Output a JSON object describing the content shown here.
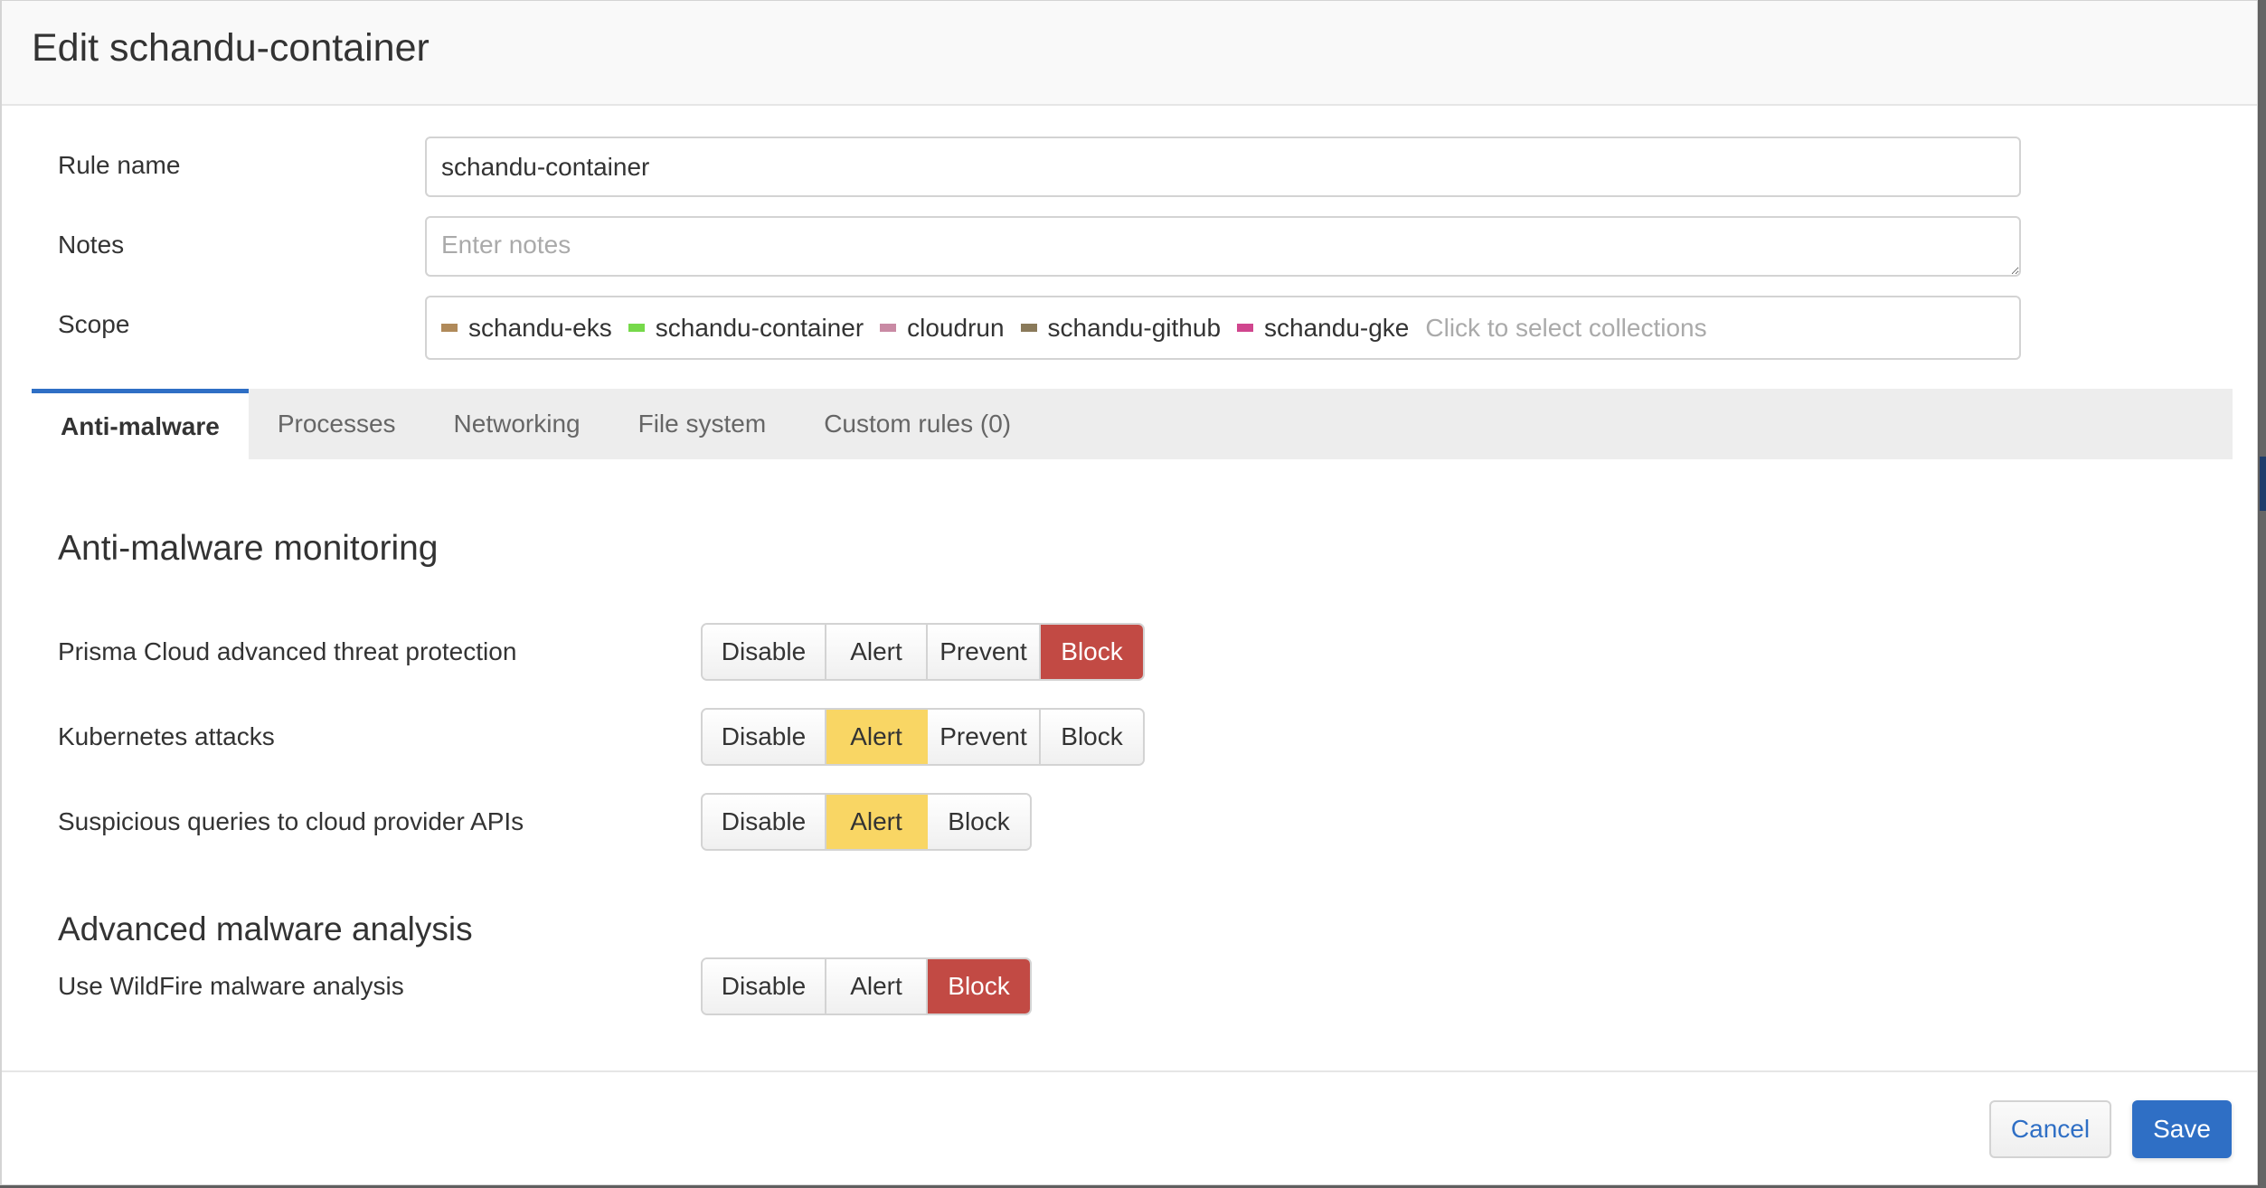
{
  "modal": {
    "title": "Edit schandu-container"
  },
  "form": {
    "rule_name": {
      "label": "Rule name",
      "value": "schandu-container"
    },
    "notes": {
      "label": "Notes",
      "value": "",
      "placeholder": "Enter notes"
    },
    "scope": {
      "label": "Scope",
      "collections": [
        {
          "name": "schandu-eks",
          "color": "#b08a5a"
        },
        {
          "name": "schandu-container",
          "color": "#76d94a"
        },
        {
          "name": "cloudrun",
          "color": "#c98aa4"
        },
        {
          "name": "schandu-github",
          "color": "#8a7a5a"
        },
        {
          "name": "schandu-gke",
          "color": "#d0468e"
        }
      ],
      "placeholder": "Click to select collections"
    }
  },
  "tabs": [
    {
      "label": "Anti-malware",
      "active": true
    },
    {
      "label": "Processes",
      "active": false
    },
    {
      "label": "Networking",
      "active": false
    },
    {
      "label": "File system",
      "active": false
    },
    {
      "label": "Custom rules (0)",
      "active": false
    }
  ],
  "anti_malware": {
    "monitoring_title": "Anti-malware monitoring",
    "settings": [
      {
        "label": "Prisma Cloud advanced threat protection",
        "options": [
          "Disable",
          "Alert",
          "Prevent",
          "Block"
        ],
        "selected": "Block"
      },
      {
        "label": "Kubernetes attacks",
        "options": [
          "Disable",
          "Alert",
          "Prevent",
          "Block"
        ],
        "selected": "Alert"
      },
      {
        "label": "Suspicious queries to cloud provider APIs",
        "options": [
          "Disable",
          "Alert",
          "Block"
        ],
        "selected": "Alert"
      }
    ],
    "advanced_title": "Advanced malware analysis",
    "wildfire": {
      "label": "Use WildFire malware analysis",
      "options": [
        "Disable",
        "Alert",
        "Block"
      ],
      "selected": "Block"
    }
  },
  "footer": {
    "cancel_label": "Cancel",
    "save_label": "Save"
  },
  "colors": {
    "accent": "#2f6fc5",
    "alert": "#f9d664",
    "block": "#c24a44"
  }
}
